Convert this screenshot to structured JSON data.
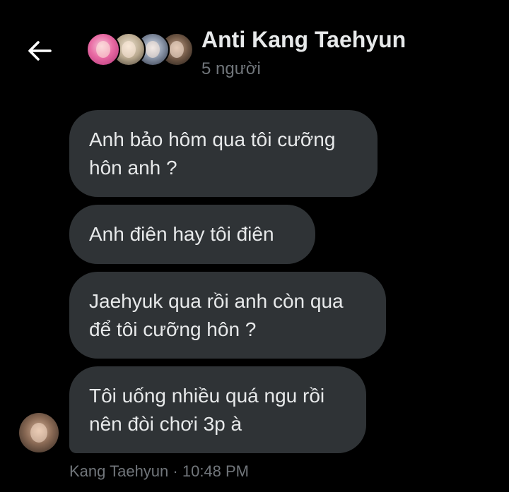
{
  "header": {
    "back_icon": "arrow-left-icon",
    "group_name": "Anti Kang Taehyun",
    "member_count": "5 người",
    "avatars": [
      "member-avatar-1",
      "member-avatar-2",
      "member-avatar-3",
      "member-avatar-4"
    ]
  },
  "messages": [
    {
      "lines": [
        "Anh bảo hôm qua tôi cưỡng",
        "hôn anh ?"
      ]
    },
    {
      "lines": [
        "Anh điên hay tôi điên"
      ]
    },
    {
      "lines": [
        "Jaehyuk qua rồi anh còn qua",
        "để tôi cưỡng hôn ?"
      ]
    },
    {
      "lines": [
        "Tôi uống nhiều quá ngu rồi",
        "nên đòi chơi 3p à"
      ]
    }
  ],
  "meta": {
    "sender": "Kang Taehyun",
    "separator": " · ",
    "time": "10:48 PM"
  },
  "colors": {
    "background": "#000000",
    "bubble": "#2f3336",
    "text": "#e7e9ea",
    "muted": "#71767b"
  }
}
